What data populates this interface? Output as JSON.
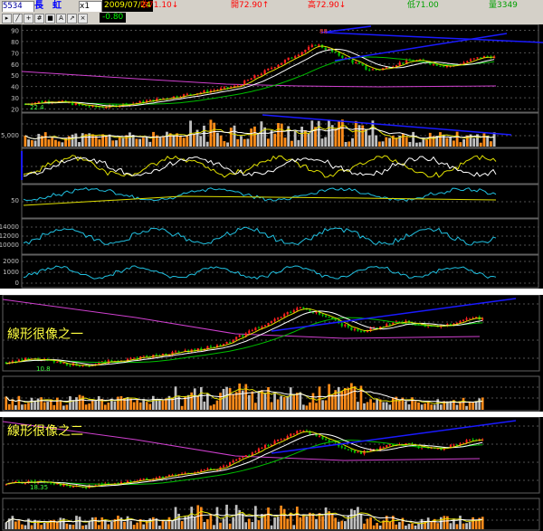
{
  "header": {
    "code": "5534",
    "name": "長　虹",
    "multiplier": "x1",
    "date": "2009/07/24",
    "close_label": "收71.10↓",
    "open_label": "開72.90↑",
    "high_label": "高72.90↓",
    "low_label": "低71.00",
    "volume_label": "量3349",
    "change": "-0.80"
  },
  "chart_data": [
    {
      "type": "candlestick",
      "y_ticks": [
        "90",
        "80",
        "70",
        "60",
        "50",
        "40",
        "30",
        "20"
      ],
      "ylim": [
        18,
        92
      ],
      "annotations": [
        "22.4"
      ],
      "high_label": "88",
      "y_ticks_vol": [
        "5,000"
      ],
      "y_ticks_ind2": [
        "50"
      ],
      "y_ticks_ind3": [
        "14000",
        "12000",
        "10000"
      ],
      "y_ticks_ind4": [
        "2000",
        "1000",
        "0"
      ]
    },
    {
      "type": "candlestick",
      "annotations": [
        "10.8"
      ],
      "caption": "線形很像之一"
    },
    {
      "type": "candlestick",
      "annotations": [
        "18.35"
      ],
      "caption": "線形很像之二"
    }
  ],
  "colors": {
    "up": "#ff2020",
    "down": "#00c000",
    "vol_up": "#ff8c1a",
    "vol_down": "#c0c0c0",
    "trend": "#1a1aff",
    "ma_long": "#d040d0",
    "ma_mid": "#00c000",
    "ma_short": "#ffffff",
    "ma_fast": "#e0e000",
    "cyan": "#20c0e0",
    "caption": "#ffff40"
  }
}
